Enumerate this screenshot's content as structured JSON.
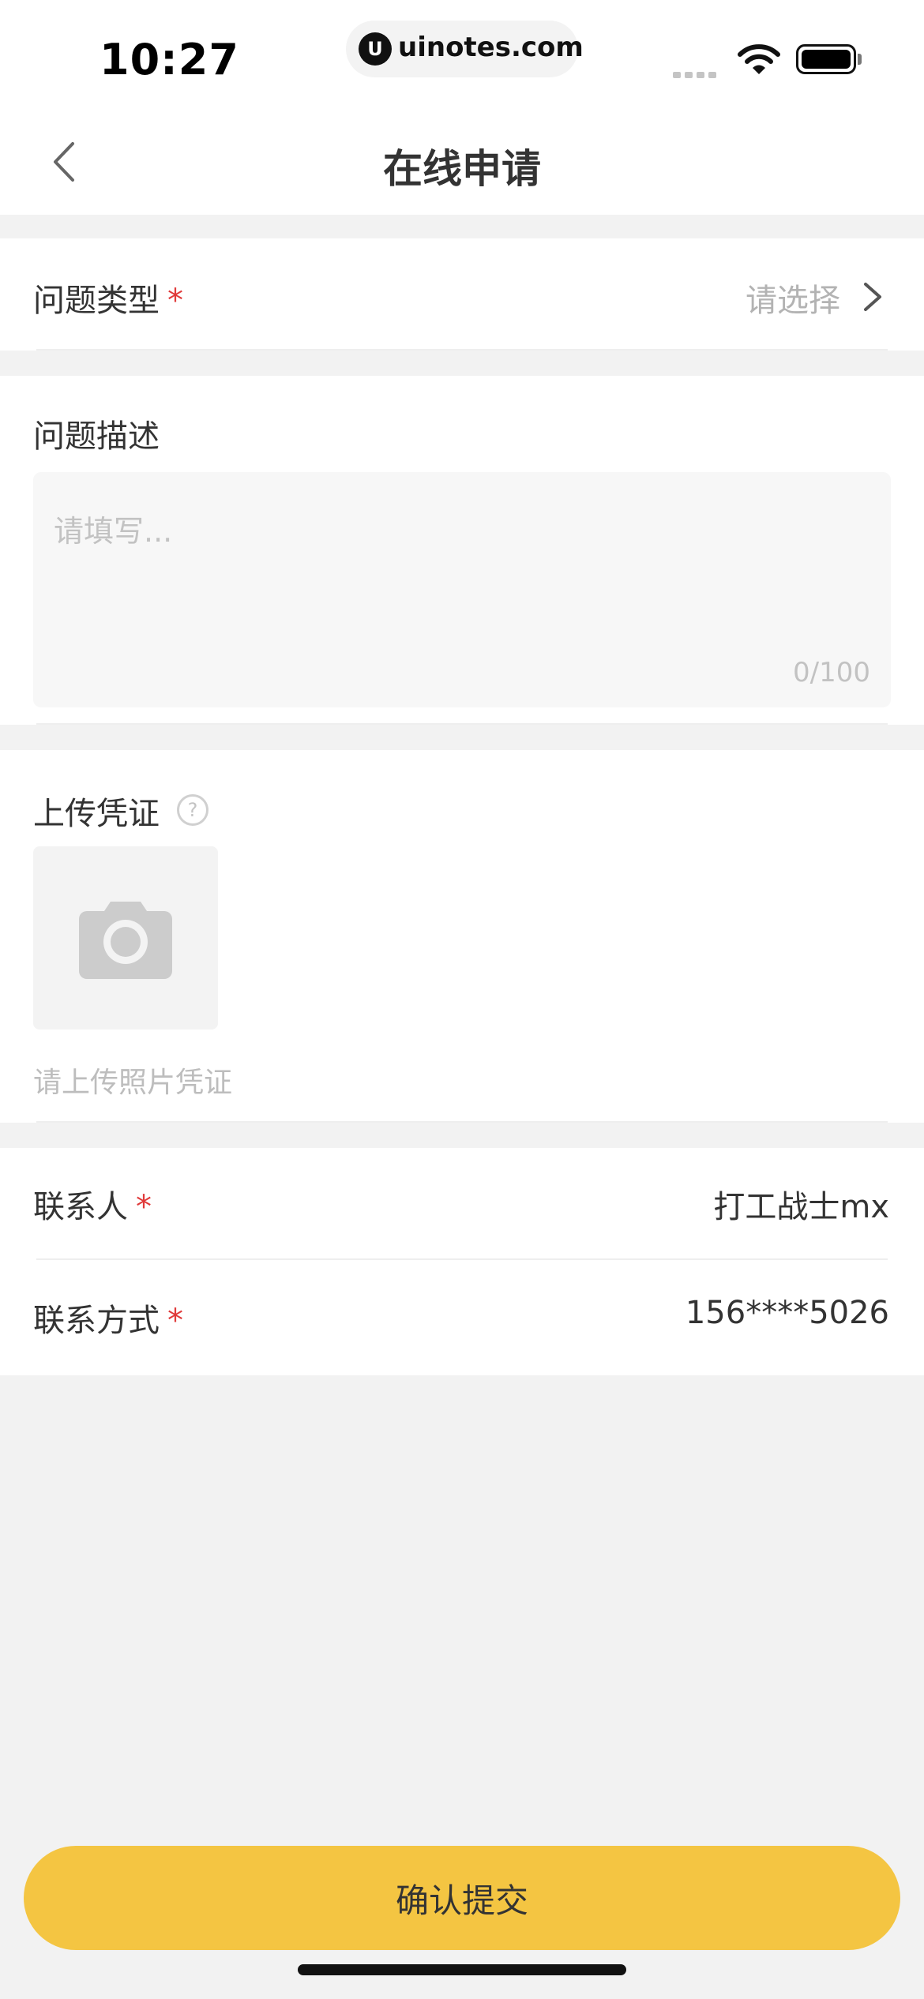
{
  "status_bar": {
    "time": "10:27",
    "url": "uinotes.com",
    "logo_letter": "U"
  },
  "header": {
    "title": "在线申请",
    "back_icon": "chevron-left-icon"
  },
  "form": {
    "issue_type": {
      "label": "问题类型",
      "required_mark": "*",
      "value": "请选择",
      "icon": "chevron-right-icon"
    },
    "description": {
      "label": "问题描述",
      "placeholder": "请填写...",
      "counter": "0/100"
    },
    "evidence": {
      "label": "上传凭证",
      "help_glyph": "?",
      "hint": "请上传照片凭证",
      "icon": "camera-icon"
    },
    "contact_person": {
      "label": "联系人",
      "required_mark": "*",
      "value": "打工战士mx"
    },
    "contact_method": {
      "label": "联系方式",
      "required_mark": "*",
      "value": "156****5026"
    }
  },
  "submit": {
    "label": "确认提交"
  },
  "colors": {
    "accent": "#f4c542",
    "required": "#e03a3a",
    "background": "#f2f2f2",
    "placeholder": "#b3b3b3"
  }
}
